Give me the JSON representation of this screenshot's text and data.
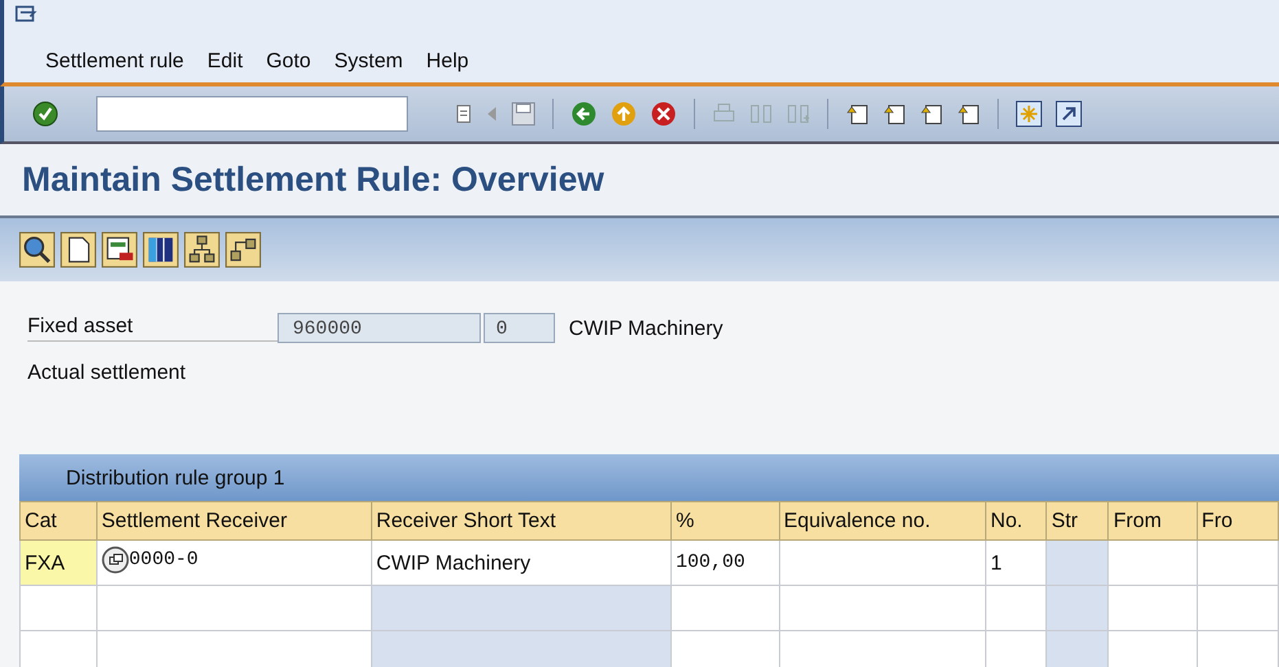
{
  "menu": [
    {
      "label": "Settlement rule"
    },
    {
      "label": "Edit"
    },
    {
      "label": "Goto"
    },
    {
      "label": "System"
    },
    {
      "label": "Help"
    }
  ],
  "title": "Maintain Settlement Rule: Overview",
  "header": {
    "label": "Fixed asset",
    "asset": "960000",
    "subnumber": "0",
    "description": "CWIP Machinery",
    "settlement_type": "Actual settlement"
  },
  "table": {
    "group_title": "Distribution rule group 1",
    "columns": [
      "Cat",
      "Settlement Receiver",
      "Receiver Short Text",
      "%",
      "Equivalence no.",
      "No.",
      "Str",
      "From",
      "Fro"
    ],
    "rows": [
      [
        "FXA",
        "0000-0",
        "CWIP Machinery",
        "100,00",
        "",
        "1",
        "",
        "",
        ""
      ],
      [
        "",
        "",
        "",
        "",
        "",
        "",
        "",
        "",
        ""
      ],
      [
        "",
        "",
        "",
        "",
        "",
        "",
        "",
        "",
        ""
      ]
    ]
  }
}
